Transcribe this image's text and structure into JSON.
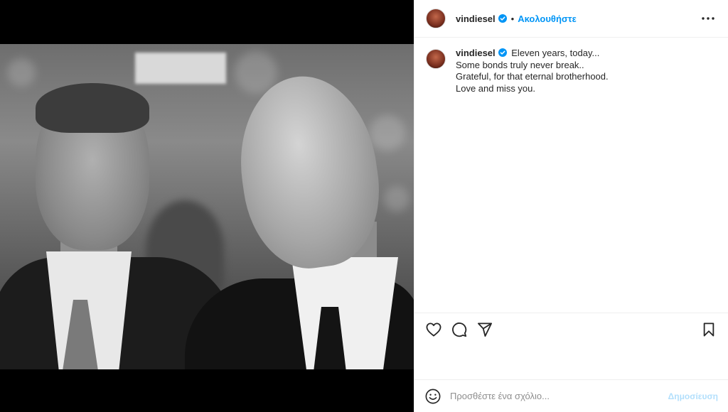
{
  "header": {
    "username": "vindiesel",
    "separator": "•",
    "follow_label": "Ακολουθήστε"
  },
  "caption": {
    "username": "vindiesel",
    "lines": [
      "Eleven years, today...",
      "Some bonds truly never break..",
      "Grateful, for that eternal brotherhood.",
      "Love and miss you."
    ]
  },
  "comment": {
    "placeholder": "Προσθέστε ένα σχόλιο...",
    "post_label": "Δημοσίευση"
  },
  "colors": {
    "accent": "#0095f6",
    "disabled_accent": "#b2dffc",
    "verified": "#0095f6"
  },
  "icons": {
    "more": "more-icon",
    "like": "heart-icon",
    "comment": "comment-icon",
    "share": "send-icon",
    "save": "bookmark-icon",
    "emoji": "emoji-icon",
    "verified": "verified-badge-icon"
  }
}
